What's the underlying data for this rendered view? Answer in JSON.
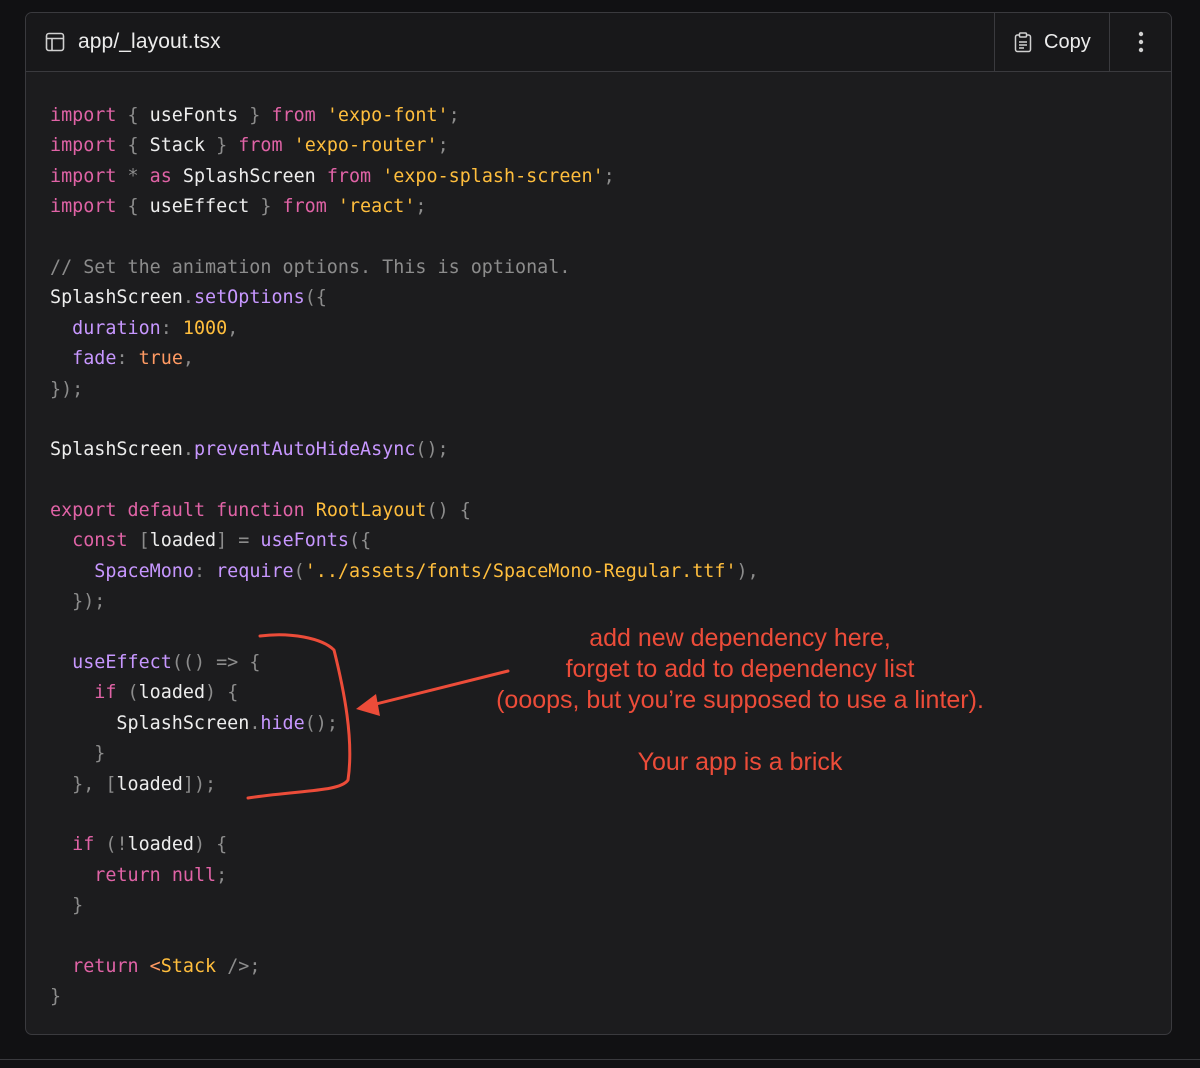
{
  "header": {
    "file_name": "app/_layout.tsx",
    "copy_label": "Copy"
  },
  "code_lines": [
    [
      {
        "t": "import",
        "c": "kw"
      },
      {
        "t": " { ",
        "c": "pun"
      },
      {
        "t": "useFonts",
        "c": "id"
      },
      {
        "t": " } ",
        "c": "pun"
      },
      {
        "t": "from",
        "c": "kw"
      },
      {
        "t": " ",
        "c": "id"
      },
      {
        "t": "'expo-font'",
        "c": "str"
      },
      {
        "t": ";",
        "c": "pun"
      }
    ],
    [
      {
        "t": "import",
        "c": "kw"
      },
      {
        "t": " { ",
        "c": "pun"
      },
      {
        "t": "Stack",
        "c": "id"
      },
      {
        "t": " } ",
        "c": "pun"
      },
      {
        "t": "from",
        "c": "kw"
      },
      {
        "t": " ",
        "c": "id"
      },
      {
        "t": "'expo-router'",
        "c": "str"
      },
      {
        "t": ";",
        "c": "pun"
      }
    ],
    [
      {
        "t": "import",
        "c": "kw"
      },
      {
        "t": " * ",
        "c": "pun"
      },
      {
        "t": "as",
        "c": "kw"
      },
      {
        "t": " SplashScreen ",
        "c": "id"
      },
      {
        "t": "from",
        "c": "kw"
      },
      {
        "t": " ",
        "c": "id"
      },
      {
        "t": "'expo-splash-screen'",
        "c": "str"
      },
      {
        "t": ";",
        "c": "pun"
      }
    ],
    [
      {
        "t": "import",
        "c": "kw"
      },
      {
        "t": " { ",
        "c": "pun"
      },
      {
        "t": "useEffect",
        "c": "id"
      },
      {
        "t": " } ",
        "c": "pun"
      },
      {
        "t": "from",
        "c": "kw"
      },
      {
        "t": " ",
        "c": "id"
      },
      {
        "t": "'react'",
        "c": "str"
      },
      {
        "t": ";",
        "c": "pun"
      }
    ],
    [],
    [
      {
        "t": "// Set the animation options. This is optional.",
        "c": "com"
      }
    ],
    [
      {
        "t": "SplashScreen",
        "c": "id"
      },
      {
        "t": ".",
        "c": "pun"
      },
      {
        "t": "setOptions",
        "c": "fn"
      },
      {
        "t": "({",
        "c": "pun"
      }
    ],
    [
      {
        "t": "  ",
        "c": "id"
      },
      {
        "t": "duration",
        "c": "prop"
      },
      {
        "t": ": ",
        "c": "pun"
      },
      {
        "t": "1000",
        "c": "num"
      },
      {
        "t": ",",
        "c": "pun"
      }
    ],
    [
      {
        "t": "  ",
        "c": "id"
      },
      {
        "t": "fade",
        "c": "prop"
      },
      {
        "t": ": ",
        "c": "pun"
      },
      {
        "t": "true",
        "c": "bool"
      },
      {
        "t": ",",
        "c": "pun"
      }
    ],
    [
      {
        "t": "});",
        "c": "pun"
      }
    ],
    [],
    [
      {
        "t": "SplashScreen",
        "c": "id"
      },
      {
        "t": ".",
        "c": "pun"
      },
      {
        "t": "preventAutoHideAsync",
        "c": "fn"
      },
      {
        "t": "();",
        "c": "pun"
      }
    ],
    [],
    [
      {
        "t": "export",
        "c": "kw"
      },
      {
        "t": " ",
        "c": "id"
      },
      {
        "t": "default",
        "c": "kw"
      },
      {
        "t": " ",
        "c": "id"
      },
      {
        "t": "function",
        "c": "kw"
      },
      {
        "t": " ",
        "c": "id"
      },
      {
        "t": "RootLayout",
        "c": "str"
      },
      {
        "t": "() {",
        "c": "pun"
      }
    ],
    [
      {
        "t": "  ",
        "c": "id"
      },
      {
        "t": "const",
        "c": "kw"
      },
      {
        "t": " [",
        "c": "pun"
      },
      {
        "t": "loaded",
        "c": "id"
      },
      {
        "t": "] = ",
        "c": "pun"
      },
      {
        "t": "useFonts",
        "c": "fn"
      },
      {
        "t": "({",
        "c": "pun"
      }
    ],
    [
      {
        "t": "    ",
        "c": "id"
      },
      {
        "t": "SpaceMono",
        "c": "prop"
      },
      {
        "t": ": ",
        "c": "pun"
      },
      {
        "t": "require",
        "c": "fn"
      },
      {
        "t": "(",
        "c": "pun"
      },
      {
        "t": "'../assets/fonts/SpaceMono-Regular.ttf'",
        "c": "str"
      },
      {
        "t": "),",
        "c": "pun"
      }
    ],
    [
      {
        "t": "  });",
        "c": "pun"
      }
    ],
    [],
    [
      {
        "t": "  ",
        "c": "id"
      },
      {
        "t": "useEffect",
        "c": "fn"
      },
      {
        "t": "(() => {",
        "c": "pun"
      }
    ],
    [
      {
        "t": "    ",
        "c": "id"
      },
      {
        "t": "if",
        "c": "kw"
      },
      {
        "t": " (",
        "c": "pun"
      },
      {
        "t": "loaded",
        "c": "id"
      },
      {
        "t": ") {",
        "c": "pun"
      }
    ],
    [
      {
        "t": "      SplashScreen",
        "c": "id"
      },
      {
        "t": ".",
        "c": "pun"
      },
      {
        "t": "hide",
        "c": "fn"
      },
      {
        "t": "();",
        "c": "pun"
      }
    ],
    [
      {
        "t": "    }",
        "c": "pun"
      }
    ],
    [
      {
        "t": "  }, [",
        "c": "pun"
      },
      {
        "t": "loaded",
        "c": "id"
      },
      {
        "t": "]);",
        "c": "pun"
      }
    ],
    [],
    [
      {
        "t": "  ",
        "c": "id"
      },
      {
        "t": "if",
        "c": "kw"
      },
      {
        "t": " (!",
        "c": "pun"
      },
      {
        "t": "loaded",
        "c": "id"
      },
      {
        "t": ") {",
        "c": "pun"
      }
    ],
    [
      {
        "t": "    ",
        "c": "id"
      },
      {
        "t": "return",
        "c": "kw"
      },
      {
        "t": " ",
        "c": "id"
      },
      {
        "t": "null",
        "c": "kw"
      },
      {
        "t": ";",
        "c": "pun"
      }
    ],
    [
      {
        "t": "  }",
        "c": "pun"
      }
    ],
    [],
    [
      {
        "t": "  ",
        "c": "id"
      },
      {
        "t": "return",
        "c": "kw"
      },
      {
        "t": " <",
        "c": "tag"
      },
      {
        "t": "Stack",
        "c": "tagname"
      },
      {
        "t": " />;",
        "c": "pun"
      }
    ],
    [
      {
        "t": "}",
        "c": "pun"
      }
    ]
  ],
  "annotation": {
    "line1": "add new dependency here,",
    "line2": "forget to add to dependency list",
    "line3": "(ooops, but you’re supposed to use a linter).",
    "line4": "Your app is a brick"
  },
  "colors": {
    "annotation": "#ec4c39",
    "keyword": "#e063a6",
    "string": "#ffbe3d",
    "function": "#c797ff",
    "punctuation": "#8c8c8c"
  },
  "icons": [
    "layout-file-icon",
    "clipboard-icon",
    "kebab-menu-icon"
  ]
}
